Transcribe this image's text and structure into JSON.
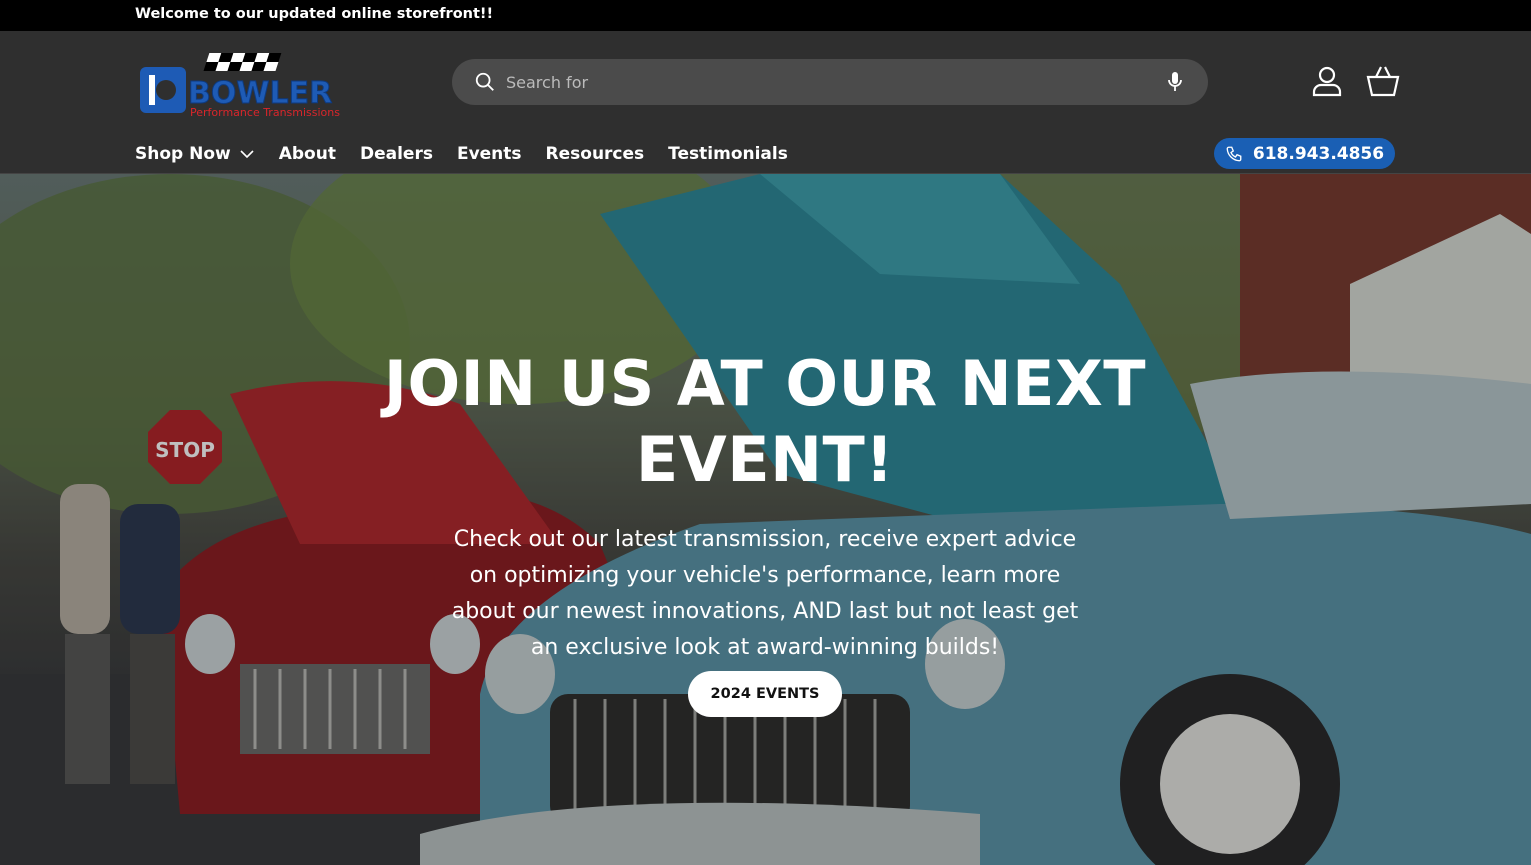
{
  "announcement": {
    "text": "Welcome to our updated online storefront!!"
  },
  "header": {
    "logo": {
      "brand": "BOWLER",
      "tagline": "Performance Transmissions"
    },
    "search": {
      "placeholder": "Search for",
      "icon": "search-icon",
      "voice_icon": "microphone-icon"
    },
    "account_icon": "user-icon",
    "cart_icon": "basket-icon",
    "nav": [
      {
        "label": "Shop Now",
        "has_dropdown": true
      },
      {
        "label": "About"
      },
      {
        "label": "Dealers"
      },
      {
        "label": "Events"
      },
      {
        "label": "Resources"
      },
      {
        "label": "Testimonials"
      }
    ],
    "phone": {
      "label": "618.943.4856",
      "icon": "phone-icon",
      "color": "#1a5fb4"
    }
  },
  "hero": {
    "headline": "JOIN US AT OUR NEXT EVENT!",
    "description": "Check out our latest transmission, receive expert advice on optimizing your vehicle's performance, learn more about our newest innovations, AND last but not least get an exclusive look at award-winning builds!",
    "cta_label": "2024 EVENTS",
    "image": "classic car show with a red and a teal vintage car with open hoods"
  }
}
